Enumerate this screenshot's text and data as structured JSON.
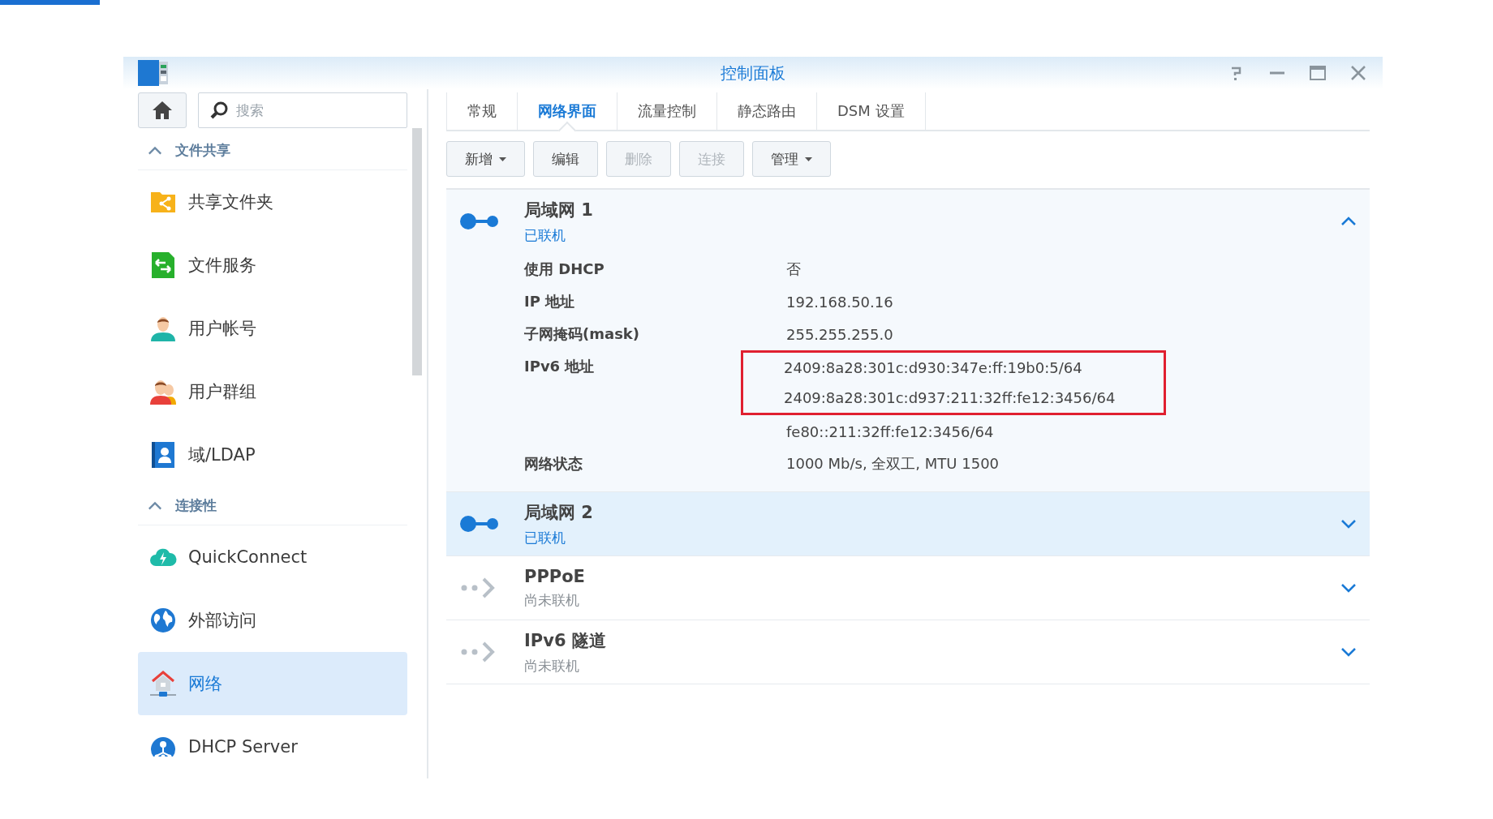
{
  "window": {
    "title": "控制面板"
  },
  "sidebar": {
    "search": {
      "placeholder": "搜索"
    },
    "sections": [
      {
        "title": "文件共享",
        "expanded": true,
        "items": [
          {
            "label": "共享文件夹",
            "kind": "shared-folder",
            "selected": false
          },
          {
            "label": "文件服务",
            "kind": "file-services",
            "selected": false
          },
          {
            "label": "用户帐号",
            "kind": "user",
            "selected": false
          },
          {
            "label": "用户群组",
            "kind": "group",
            "selected": false
          },
          {
            "label": "域/LDAP",
            "kind": "directory",
            "selected": false
          }
        ]
      },
      {
        "title": "连接性",
        "expanded": true,
        "items": [
          {
            "label": "QuickConnect",
            "kind": "cloud",
            "selected": false
          },
          {
            "label": "外部访问",
            "kind": "globe",
            "selected": false
          },
          {
            "label": "网络",
            "kind": "network",
            "selected": true
          },
          {
            "label": "DHCP Server",
            "kind": "dhcp",
            "selected": false
          }
        ]
      }
    ]
  },
  "tabs": [
    {
      "label": "常规",
      "selected": false
    },
    {
      "label": "网络界面",
      "selected": true
    },
    {
      "label": "流量控制",
      "selected": false
    },
    {
      "label": "静态路由",
      "selected": false
    },
    {
      "label": "DSM 设置",
      "selected": false
    }
  ],
  "toolbar": [
    {
      "label": "新增",
      "dropdown": true,
      "disabled": false
    },
    {
      "label": "编辑",
      "dropdown": false,
      "disabled": false
    },
    {
      "label": "删除",
      "dropdown": false,
      "disabled": true
    },
    {
      "label": "连接",
      "dropdown": false,
      "disabled": true
    },
    {
      "label": "管理",
      "dropdown": true,
      "disabled": false
    }
  ],
  "interfaces": [
    {
      "name": "局域网 1",
      "status": "已联机",
      "connected": true,
      "expanded": true,
      "selected": false,
      "details": [
        {
          "label": "使用 DHCP",
          "values": [
            {
              "text": "否",
              "highlighted": false
            }
          ]
        },
        {
          "label": "IP 地址",
          "values": [
            {
              "text": "192.168.50.16",
              "highlighted": false
            }
          ]
        },
        {
          "label": "子网掩码(mask)",
          "values": [
            {
              "text": "255.255.255.0",
              "highlighted": false
            }
          ]
        },
        {
          "label": "IPv6 地址",
          "values": [
            {
              "text": "2409:8a28:301c:d930:347e:ff:19b0:5/64",
              "highlighted": true
            },
            {
              "text": "2409:8a28:301c:d937:211:32ff:fe12:3456/64",
              "highlighted": true
            },
            {
              "text": "fe80::211:32ff:fe12:3456/64",
              "highlighted": false
            }
          ]
        },
        {
          "label": "网络状态",
          "values": [
            {
              "text": "1000 Mb/s, 全双工, MTU 1500",
              "highlighted": false
            }
          ]
        }
      ]
    },
    {
      "name": "局域网 2",
      "status": "已联机",
      "connected": true,
      "expanded": false,
      "selected": true
    },
    {
      "name": "PPPoE",
      "status": "尚未联机",
      "connected": false,
      "expanded": false,
      "selected": false
    },
    {
      "name": "IPv6 隧道",
      "status": "尚未联机",
      "connected": false,
      "expanded": false,
      "selected": false
    }
  ]
}
